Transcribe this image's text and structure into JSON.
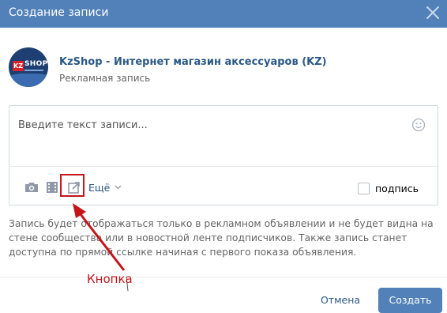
{
  "dialog": {
    "title": "Создание записи"
  },
  "author": {
    "avatar_badge": "KZ",
    "avatar_text": "SHOP",
    "name": "KzShop - Интернет магазин аксессуаров (KZ)",
    "subtitle": "Рекламная запись"
  },
  "editor": {
    "placeholder": "Введите текст записи...",
    "more_label": "Ещё",
    "signature_label": "подпись",
    "signature_checked": false
  },
  "note": "Запись будет отображаться только в рекламном объявлении и не будет видна на стене сообщества или в новостной ленте подписчиков. Также запись станет доступна по прямой ссылке начиная с первого показа объявления.",
  "buttons": {
    "cancel": "Отмена",
    "create": "Создать"
  },
  "annotation": {
    "label": "Кнопка",
    "color": "#c3151a"
  },
  "colors": {
    "header": "#5181b8",
    "link": "#2a5885",
    "muted": "#656565"
  },
  "icons": [
    "close-icon",
    "smile-icon",
    "camera-icon",
    "video-icon",
    "share-icon",
    "chevron-down-icon"
  ]
}
